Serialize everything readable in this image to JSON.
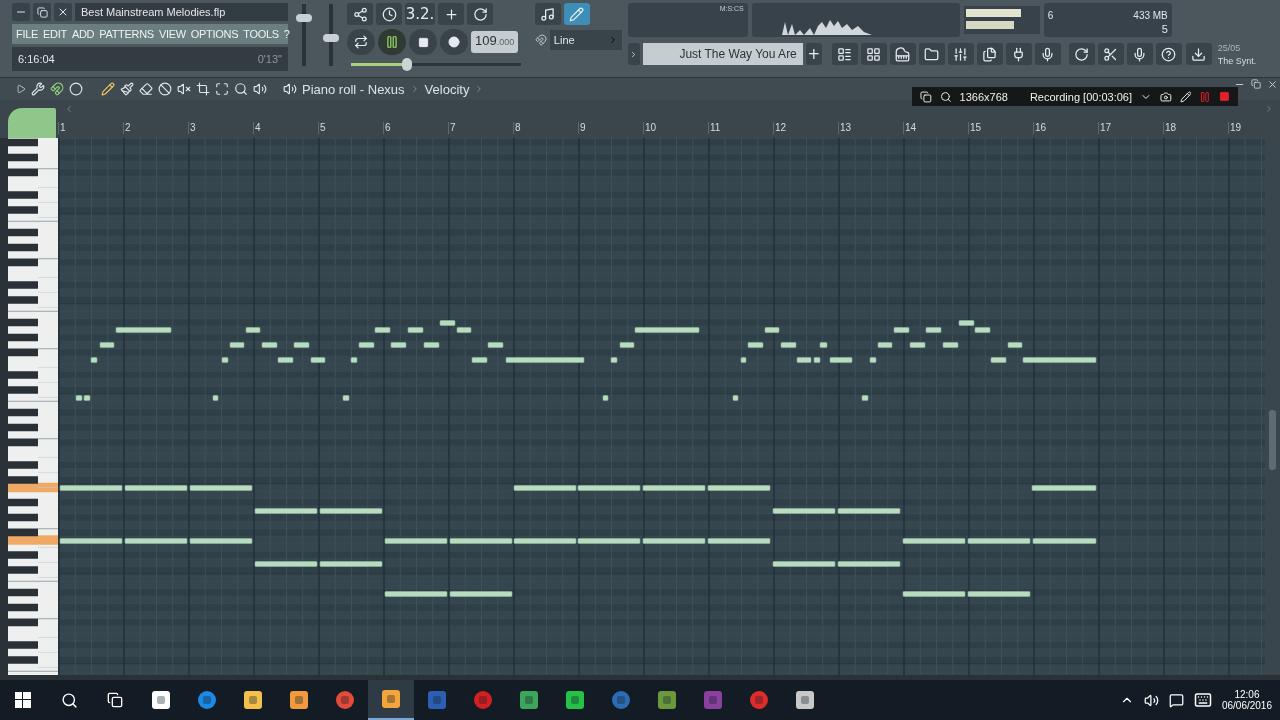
{
  "project": {
    "title": "Best Mainstream Melodies.flp",
    "time": "6:16:04",
    "duration": "0'13\""
  },
  "menu": [
    "FILE",
    "EDIT",
    "ADD",
    "PATTERNS",
    "VIEW",
    "OPTIONS",
    "TOOLS",
    "?"
  ],
  "transport": {
    "playing": true,
    "pattern_mode": "3.2.",
    "tempo": "109",
    "tempo_fraction": ".000",
    "snap": "Line",
    "time_format": "M:S:CS"
  },
  "master_pitch": {
    "level": 0.33
  },
  "cpu": {
    "value": "6",
    "memory": "433 MB",
    "polyphony": "5"
  },
  "pattern": {
    "name": "Just The Way You Are",
    "add": "+"
  },
  "news": {
    "date": "25/05",
    "title": "The Synt."
  },
  "piano_roll": {
    "breadcrumb": [
      "Piano roll - Nexus",
      "Velocity"
    ],
    "ruler": [
      "1",
      "2",
      "3",
      "4",
      "5",
      "6",
      "7",
      "8",
      "9",
      "10",
      "11",
      "12",
      "13",
      "14",
      "15",
      "16",
      "17",
      "18",
      "19"
    ]
  },
  "recorder": {
    "resolution": "1366x768",
    "status": "Recording [00:03:06]"
  },
  "taskbar": {
    "clock": "12:06",
    "date": "06/06/2016"
  }
}
